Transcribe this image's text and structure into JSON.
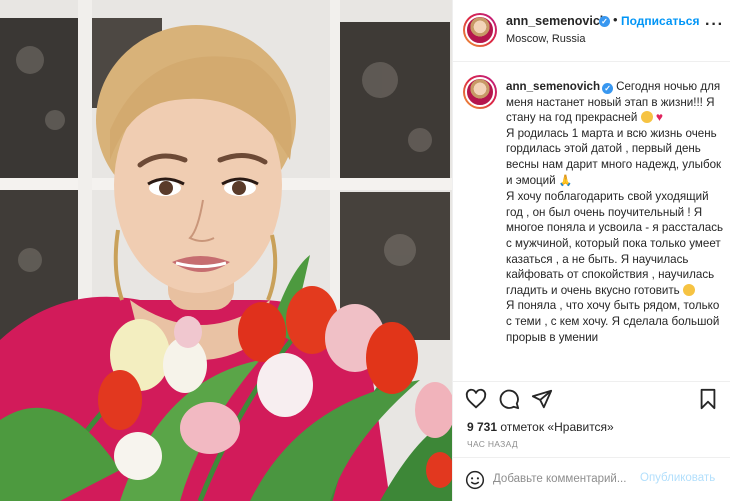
{
  "post": {
    "username": "ann_semenovich",
    "follow_label": "Подписаться",
    "location": "Moscow, Russia",
    "more_label": "···",
    "caption_lines": [
      "Сегодня ночью для меня настанет новый этап в жизни!!! Я стану на год прекрасней",
      "Я родилась 1 марта и всю жизнь очень гордилась этой датой , первый день весны нам дарит много надежд, улыбок и эмоций",
      "Я хочу поблагодарить свой уходящий год , он был очень поучительный ! Я многое поняла и усвоила - я рассталась с мужчиной, который пока только умеет казаться , а не быть. Я научилась кайфовать от спокойствия , научилась гладить и очень вкусно готовить",
      "Я поняла , что хочу быть рядом, только с теми , с кем хочу. Я сделала большой прорыв в умении"
    ],
    "likes_count": "9 731",
    "likes_text": "отметок «Нравится»",
    "time": "ЧАС НАЗАД",
    "comment_placeholder": "Добавьте комментарий...",
    "publish_label": "Опубликовать"
  },
  "icons": {
    "verified": "verified-badge-icon",
    "like": "heart-icon",
    "comment": "comment-icon",
    "share": "share-icon",
    "save": "bookmark-icon",
    "emoji": "smile-icon"
  },
  "colors": {
    "link_blue": "#0095f6",
    "verified_blue": "#3897f0",
    "publish_disabled": "#b2dffc",
    "border": "#efefef",
    "muted": "#8e8e8e"
  }
}
